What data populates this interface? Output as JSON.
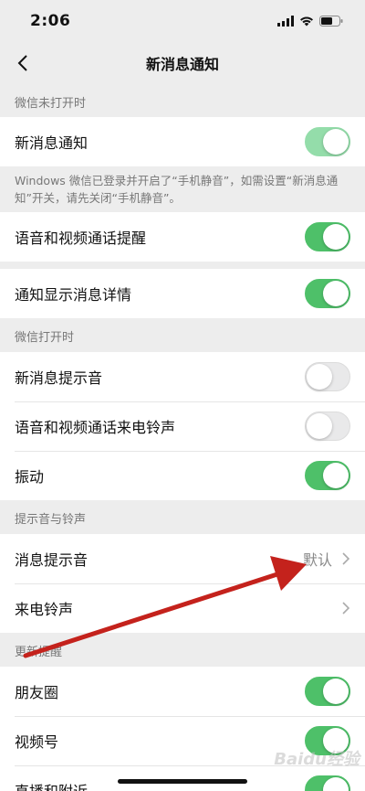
{
  "status_bar": {
    "time": "2:06"
  },
  "nav": {
    "title": "新消息通知"
  },
  "sections": {
    "closed": "微信未打开时",
    "open": "微信打开时",
    "sounds": "提示音与铃声",
    "updates": "更新提醒"
  },
  "rows": {
    "new_message": {
      "label": "新消息通知",
      "state": "on-disabled"
    },
    "voice_video_alert": {
      "label": "语音和视频通话提醒",
      "state": "on"
    },
    "show_details": {
      "label": "通知显示消息详情",
      "state": "on"
    },
    "message_tone": {
      "label": "新消息提示音",
      "state": "off"
    },
    "call_ringtone": {
      "label": "语音和视频通话来电铃声",
      "state": "off"
    },
    "vibrate": {
      "label": "振动",
      "state": "on"
    },
    "message_sound": {
      "label": "消息提示音",
      "value": "默认"
    },
    "incoming_ringtone": {
      "label": "来电铃声"
    },
    "moments": {
      "label": "朋友圈",
      "state": "on"
    },
    "channels": {
      "label": "视频号",
      "state": "on"
    },
    "live_nearby": {
      "label": "直播和附近",
      "state": "on"
    }
  },
  "note": {
    "text": "Windows 微信已登录并开启了“手机静音”，如需设置“新消息通知”开关，请先关闭“手机静音”。"
  },
  "colors": {
    "toggle_on": "#4ec069",
    "toggle_dim": "#94ddaa",
    "arrow": "#c4221c"
  },
  "watermark": {
    "text": "Baidu经验"
  }
}
